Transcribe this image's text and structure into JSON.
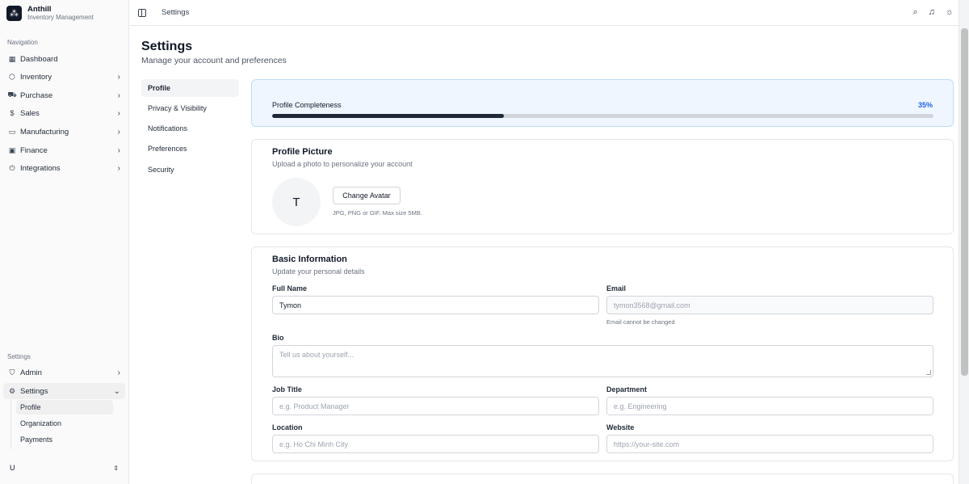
{
  "brand": {
    "name": "Anthill",
    "subtitle": "Inventory Management",
    "logo_icon": "ant-logo-icon"
  },
  "sidebar": {
    "nav_label": "Navigation",
    "nav_items": [
      {
        "label": "Dashboard",
        "icon": "grid-icon",
        "has_chevron": false
      },
      {
        "label": "Inventory",
        "icon": "box-icon",
        "has_chevron": true
      },
      {
        "label": "Purchase",
        "icon": "truck-icon",
        "has_chevron": true
      },
      {
        "label": "Sales",
        "icon": "dollar-icon",
        "has_chevron": true
      },
      {
        "label": "Manufacturing",
        "icon": "factory-icon",
        "has_chevron": true
      },
      {
        "label": "Finance",
        "icon": "wallet-icon",
        "has_chevron": true
      },
      {
        "label": "Integrations",
        "icon": "plug-icon",
        "has_chevron": true
      }
    ],
    "settings_label": "Settings",
    "settings_items": [
      {
        "label": "Admin",
        "icon": "shield-icon"
      },
      {
        "label": "Settings",
        "icon": "gear-icon"
      }
    ],
    "settings_sub_items": [
      "Profile",
      "Organization",
      "Payments"
    ],
    "user_initial": "U"
  },
  "topbar": {
    "breadcrumb": "Settings",
    "icons": [
      "search-icon",
      "bell-icon",
      "sun-icon"
    ]
  },
  "page": {
    "title": "Settings",
    "subtitle": "Manage your account and preferences"
  },
  "settings_nav": [
    "Profile",
    "Privacy & Visibility",
    "Notifications",
    "Preferences",
    "Security"
  ],
  "progress": {
    "label": "Profile Completeness",
    "percent_text": "35%",
    "value": 0.35,
    "accent": "#2563eb"
  },
  "profile_picture": {
    "title": "Profile Picture",
    "description": "Upload a photo to personalize your account",
    "avatar_initial": "T",
    "button_label": "Change Avatar",
    "hint": "JPG, PNG or GIF. Max size 5MB."
  },
  "basic_info": {
    "title": "Basic Information",
    "description": "Update your personal details",
    "full_name": {
      "label": "Full Name",
      "value": "Tymon"
    },
    "email": {
      "label": "Email",
      "value": "tymon3568@gmail.com",
      "help": "Email cannot be changed"
    },
    "bio": {
      "label": "Bio",
      "placeholder": "Tell us about yourself..."
    },
    "job_title": {
      "label": "Job Title",
      "placeholder": "e.g. Product Manager"
    },
    "department": {
      "label": "Department",
      "placeholder": "e.g. Engineering"
    },
    "location": {
      "label": "Location",
      "placeholder": "e.g. Ho Chi Minh City"
    },
    "website": {
      "label": "Website",
      "placeholder": "https://your-site.com"
    }
  }
}
